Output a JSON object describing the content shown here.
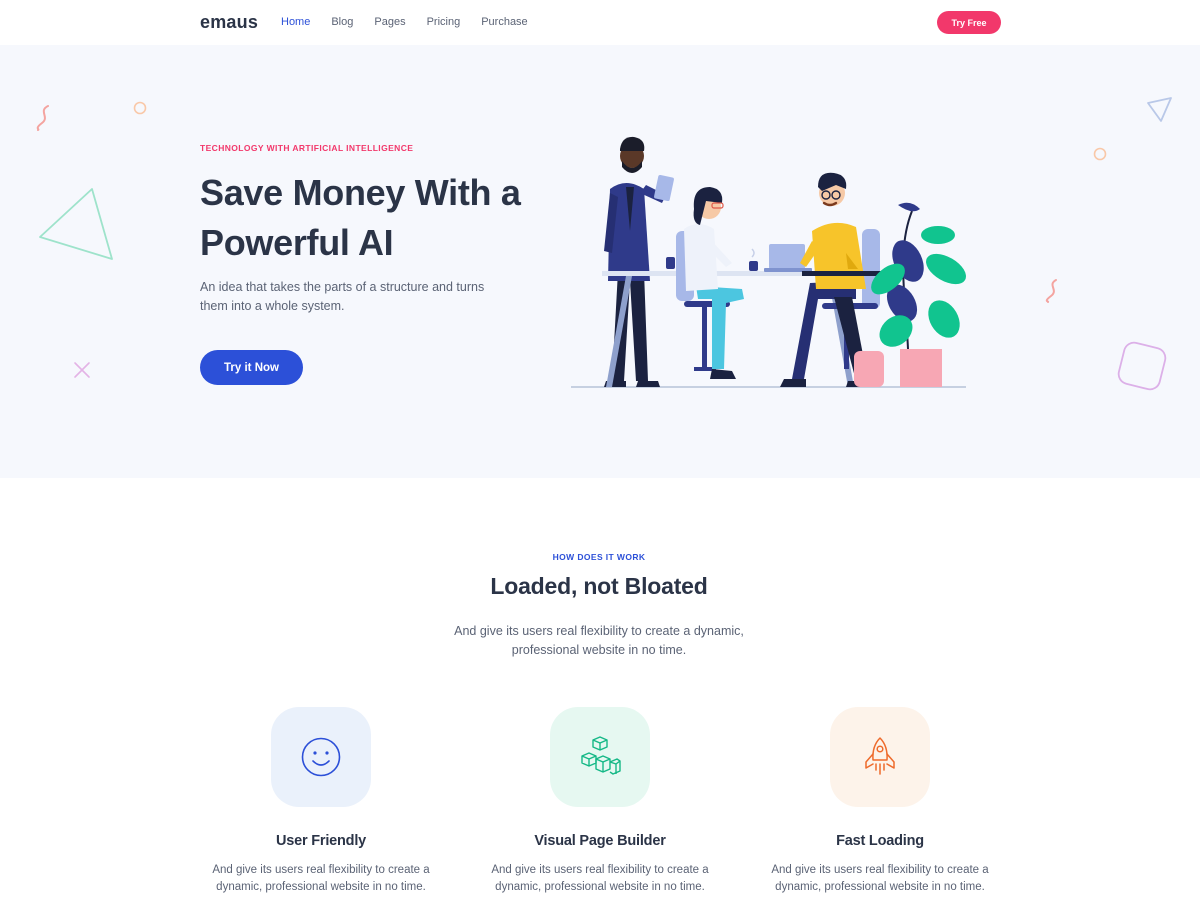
{
  "nav": {
    "brand": "emaus",
    "items": [
      "Home",
      "Blog",
      "Pages",
      "Pricing",
      "Purchase"
    ],
    "active_item": "Home",
    "cta_label": "Try Free"
  },
  "hero": {
    "eyebrow": "TECHNOLOGY WITH ARTIFICIAL INTELLIGENCE",
    "title": "Save Money With a Powerful AI",
    "description": "An idea that takes the parts of a structure and turns them into a whole system.",
    "cta_label": "Try it Now"
  },
  "how": {
    "eyebrow": "HOW DOES IT WORK",
    "title": "Loaded, not Bloated",
    "description": "And give its users real flexibility to create a dynamic, professional website in no time."
  },
  "features": [
    {
      "icon": "smiley-icon",
      "title": "User Friendly",
      "description": "And give its users real flexibility to create a dynamic, professional website in no time.",
      "tile_color": "#eaf1fb"
    },
    {
      "icon": "cubes-icon",
      "title": "Visual Page Builder",
      "description": "And give its users real flexibility to create a dynamic, professional website in no time.",
      "tile_color": "#e6f8f1"
    },
    {
      "icon": "rocket-icon",
      "title": "Fast Loading",
      "description": "And give its users real flexibility to create a dynamic, professional website in no time.",
      "tile_color": "#fdf3ea"
    }
  ],
  "colors": {
    "primary": "#2c50d8",
    "accent": "#f2386b",
    "heading": "#2b3447",
    "hero_bg": "#f6f8fd"
  }
}
